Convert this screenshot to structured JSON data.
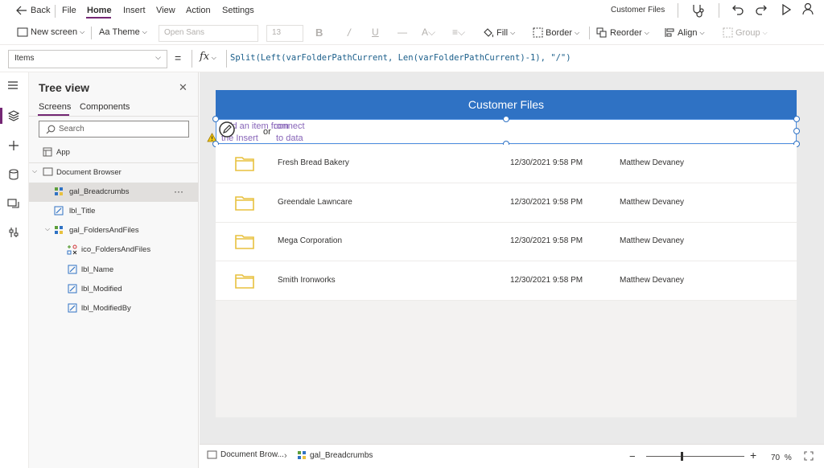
{
  "menu": {
    "back_label": "Back",
    "items": [
      "File",
      "Home",
      "Insert",
      "View",
      "Action",
      "Settings"
    ],
    "active": "Home",
    "app_name": "Customer Files"
  },
  "toolbar": {
    "new_screen": "New screen",
    "theme": "Theme",
    "font": "Open Sans",
    "font_size": "13",
    "fill": "Fill",
    "border": "Border",
    "reorder": "Reorder",
    "align": "Align",
    "group": "Group"
  },
  "formula_bar": {
    "property": "Items",
    "equals": "=",
    "fx": "fx",
    "formula": "Split(Left(varFolderPathCurrent, Len(varFolderPathCurrent)-1), \"/\")"
  },
  "tree_view": {
    "title": "Tree view",
    "tabs": [
      "Screens",
      "Components"
    ],
    "search_placeholder": "Search",
    "items": [
      {
        "label": "App",
        "indent": 0
      },
      {
        "label": "Document Browser",
        "indent": 0
      },
      {
        "label": "gal_Breadcrumbs",
        "indent": 1,
        "selected": true,
        "more": "···"
      },
      {
        "label": "lbl_Title",
        "indent": 1
      },
      {
        "label": "gal_FoldersAndFiles",
        "indent": 1
      },
      {
        "label": "ico_FoldersAndFiles",
        "indent": 2
      },
      {
        "label": "lbl_Name",
        "indent": 2
      },
      {
        "label": "lbl_Modified",
        "indent": 2
      },
      {
        "label": "lbl_ModifiedBy",
        "indent": 2
      }
    ]
  },
  "canvas": {
    "title": "Customer Files",
    "breadcrumb_placeholder": {
      "part1_line1": "Add an item from",
      "part1_line2": "the Insert",
      "or": "or",
      "part2_line1": "connect",
      "part2_line2": "to data"
    },
    "files": [
      {
        "name": "Fresh Bread Bakery",
        "modified": "12/30/2021 9:58 PM",
        "modified_by": "Matthew Devaney"
      },
      {
        "name": "Greendale Lawncare",
        "modified": "12/30/2021 9:58 PM",
        "modified_by": "Matthew Devaney"
      },
      {
        "name": "Mega Corporation",
        "modified": "12/30/2021 9:58 PM",
        "modified_by": "Matthew Devaney"
      },
      {
        "name": "Smith Ironworks",
        "modified": "12/30/2021 9:58 PM",
        "modified_by": "Matthew Devaney"
      }
    ]
  },
  "status_bar": {
    "screen": "Document Brow...",
    "control": "gal_Breadcrumbs",
    "zoom_minus": "−",
    "zoom_plus": "+",
    "zoom_value": "70",
    "zoom_unit": "%"
  },
  "colors": {
    "accent": "#742774",
    "title_bar": "#2f72c4",
    "folder": "#e8c13f",
    "placeholder_text": "#8764b8"
  }
}
